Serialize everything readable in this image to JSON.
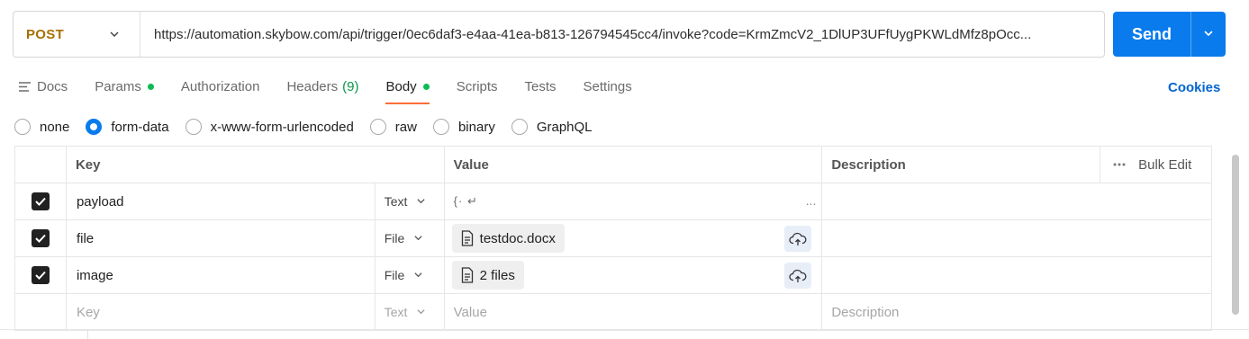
{
  "request": {
    "method": "POST",
    "url": "https://automation.skybow.com/api/trigger/0ec6daf3-e4aa-41ea-b813-126794545cc4/invoke?code=KrmZmcV2_1DlUP3UFfUygPKWLdMfz8pOcc..."
  },
  "send_label": "Send",
  "tabs": [
    {
      "label": "Docs"
    },
    {
      "label": "Params"
    },
    {
      "label": "Authorization"
    },
    {
      "label": "Headers",
      "count": "(9)"
    },
    {
      "label": "Body"
    },
    {
      "label": "Scripts"
    },
    {
      "label": "Tests"
    },
    {
      "label": "Settings"
    }
  ],
  "cookies_label": "Cookies",
  "body_types": [
    "none",
    "form-data",
    "x-www-form-urlencoded",
    "raw",
    "binary",
    "GraphQL"
  ],
  "body_type_selected": "form-data",
  "table": {
    "headers": {
      "key": "Key",
      "value": "Value",
      "description": "Description",
      "bulk_edit": "Bulk Edit"
    },
    "rows": [
      {
        "key": "payload",
        "type": "Text",
        "value": "{· ↵",
        "value_ellipsis": "...",
        "checked": true
      },
      {
        "key": "file",
        "type": "File",
        "value": "testdoc.docx",
        "checked": true
      },
      {
        "key": "image",
        "type": "File",
        "value": "2 files",
        "checked": true
      }
    ],
    "placeholder": {
      "key": "Key",
      "type": "Text",
      "value": "Value",
      "description": "Description"
    }
  },
  "colors": {
    "accent": "#097bed",
    "method": "#a77000",
    "active_tab": "#ff6c37",
    "dot": "#0cbb52"
  }
}
